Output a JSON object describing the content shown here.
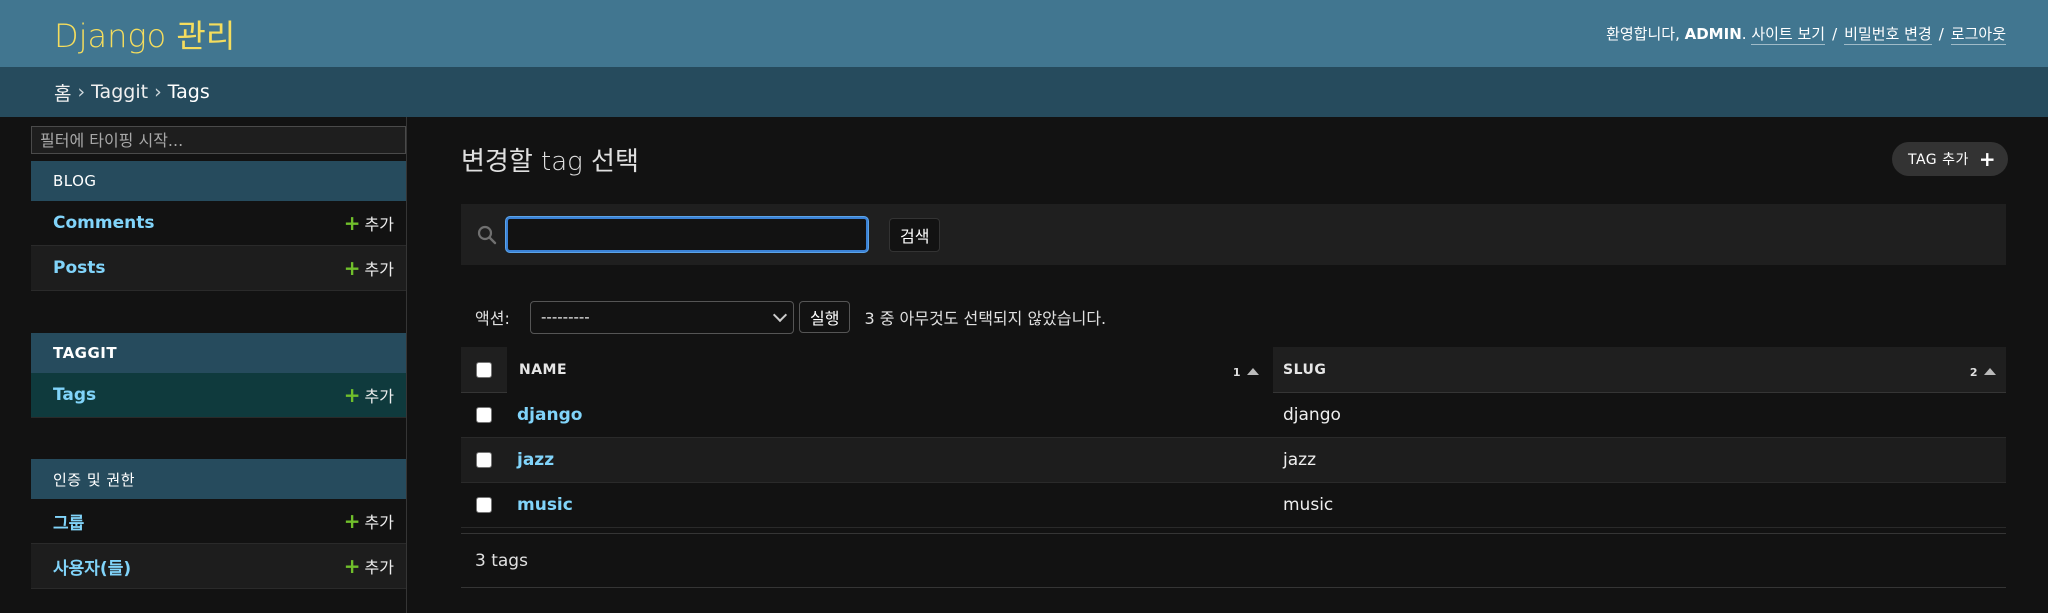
{
  "header": {
    "brand": "Django 관리",
    "welcome": "환영합니다,",
    "username": "ADMIN",
    "period": ".",
    "view_site": "사이트 보기",
    "change_password": "비밀번호 변경",
    "logout": "로그아웃",
    "separator": "/"
  },
  "breadcrumbs": {
    "home": "홈",
    "app": "Taggit",
    "current": "Tags",
    "chevron": "›"
  },
  "sidebar": {
    "filter_placeholder": "필터에 타이핑 시작...",
    "add_label": "추가",
    "modules": [
      {
        "caption": "BLOG",
        "models": [
          "Comments",
          "Posts"
        ]
      },
      {
        "caption": "TAGGIT",
        "models": [
          "Tags"
        ]
      },
      {
        "caption": "인증 및 권한",
        "models": [
          "그룹",
          "사용자(들)"
        ]
      }
    ]
  },
  "main": {
    "title": "변경할 tag 선택",
    "add_button": "TAG 추가",
    "search_button": "검색",
    "search_value": "",
    "actions_label": "액션:",
    "action_selected": "---------",
    "run_button": "실행",
    "action_counter": "3 중 아무것도 선택되지 않았습니다.",
    "columns": {
      "name": "NAME",
      "name_sort_priority": "1",
      "slug": "SLUG",
      "slug_sort_priority": "2"
    },
    "rows": [
      {
        "name": "django",
        "slug": "django"
      },
      {
        "name": "jazz",
        "slug": "jazz"
      },
      {
        "name": "music",
        "slug": "music"
      }
    ],
    "paginator": "3 tags"
  },
  "colors": {
    "header_bg": "#417690",
    "breadcrumbs_bg": "#264b5d",
    "brand": "#f5dd5d",
    "link": "#81d4fa",
    "add_plus": "#70bf2b",
    "active_row": "#0f3a3d"
  },
  "icons": {
    "search": "search-icon",
    "plus": "plus-icon",
    "sort": "sort-asc-icon",
    "select": "chevron-down-icon"
  }
}
